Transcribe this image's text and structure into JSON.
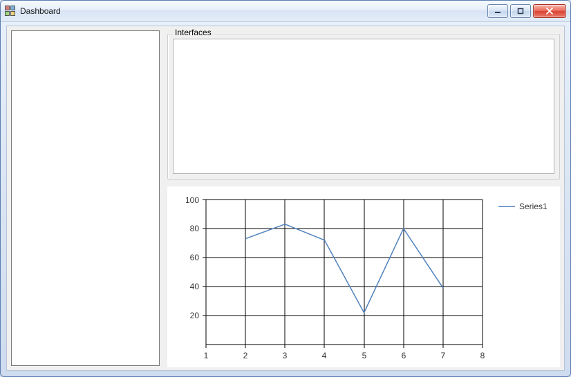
{
  "window": {
    "title": "Dashboard"
  },
  "groupbox": {
    "interfaces_label": "Interfaces"
  },
  "chart": {
    "legend": {
      "series1": "Series1"
    },
    "y_ticks": [
      "20",
      "40",
      "60",
      "80",
      "100"
    ],
    "x_ticks": [
      "1",
      "2",
      "3",
      "4",
      "5",
      "6",
      "7",
      "8"
    ]
  },
  "chart_data": {
    "type": "line",
    "title": "",
    "xlabel": "",
    "ylabel": "",
    "xlim": [
      1,
      8
    ],
    "ylim": [
      0,
      100
    ],
    "x": [
      2,
      3,
      4,
      5,
      6,
      7
    ],
    "series": [
      {
        "name": "Series1",
        "values": [
          73,
          83,
          72,
          22,
          80,
          39
        ]
      }
    ]
  }
}
